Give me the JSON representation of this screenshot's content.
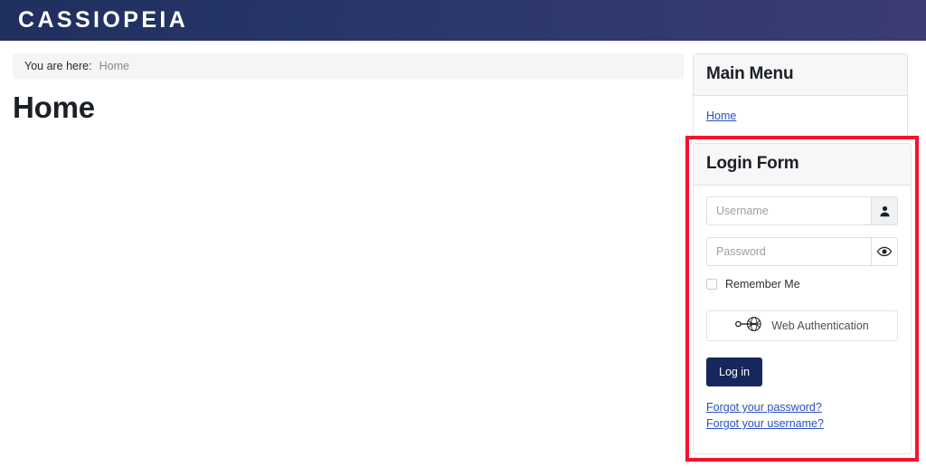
{
  "header": {
    "brand": "CASSIOPEIA"
  },
  "breadcrumb": {
    "label": "You are here:",
    "current": "Home"
  },
  "main": {
    "page_title": "Home"
  },
  "sidebar": {
    "main_menu": {
      "title": "Main Menu",
      "items": [
        {
          "label": "Home"
        }
      ]
    },
    "login_form": {
      "title": "Login Form",
      "username": {
        "value": "",
        "placeholder": "Username",
        "icon": "user-icon"
      },
      "password": {
        "value": "",
        "placeholder": "Password",
        "icon": "eye-icon"
      },
      "remember_me": {
        "label": "Remember Me",
        "checked": false
      },
      "webauthn": {
        "label": "Web Authentication",
        "icon": "webauthn-key-globe-icon"
      },
      "submit_label": "Log in",
      "links": [
        {
          "label": "Forgot your password?"
        },
        {
          "label": "Forgot your username?"
        }
      ]
    }
  },
  "colors": {
    "header_start": "#1f2f5e",
    "header_end": "#3b3c72",
    "highlight_border": "#f8102e",
    "link": "#2a4fc4",
    "button": "#16275c"
  }
}
